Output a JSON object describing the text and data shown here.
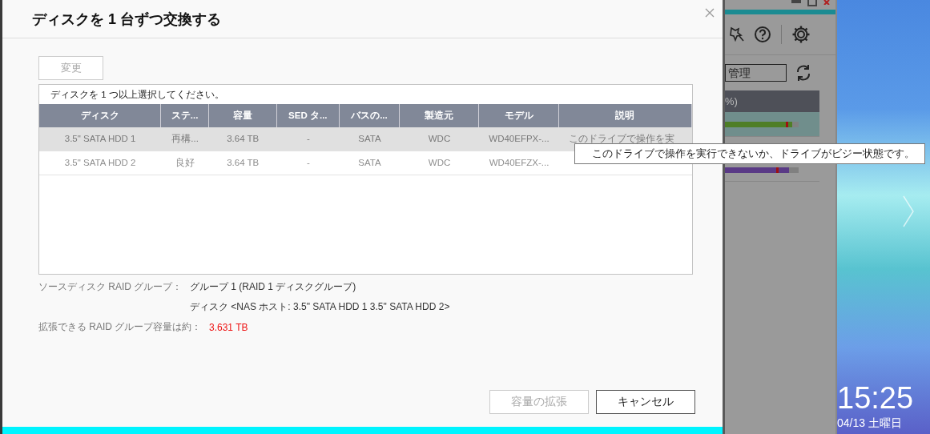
{
  "dialog": {
    "title": "ディスクを 1 台ずつ交換する",
    "change_button": {
      "label": "変更",
      "disabled": true
    },
    "table": {
      "caption": "ディスクを 1 つ以上選択してください。",
      "columns": [
        "ディスク",
        "ステ...",
        "容量",
        "SED タ...",
        "バスの...",
        "製造元",
        "モデル",
        "説明"
      ],
      "rows": [
        {
          "selected": true,
          "disabled": true,
          "cells": [
            "3.5\" SATA HDD 1",
            "再構...",
            "3.64 TB",
            "-",
            "SATA",
            "WDC",
            "WD40EFPX-...",
            "このドライブで操作を実"
          ]
        },
        {
          "selected": false,
          "disabled": true,
          "cells": [
            "3.5\" SATA HDD 2",
            "良好",
            "3.64 TB",
            "-",
            "SATA",
            "WDC",
            "WD40EFZX-..."
          ]
        }
      ]
    },
    "source_label": "ソースディスク RAID グループ：",
    "source_group": "グループ 1 (RAID 1 ディスクグループ)",
    "source_disks": "ディスク <NAS ホスト: 3.5\" SATA HDD 1 3.5\" SATA HDD 2>",
    "capacity_label": "拡張できる RAID グループ容量は約：",
    "capacity_value": "3.631 TB",
    "buttons": [
      {
        "label": "容量の拡張",
        "disabled": true
      },
      {
        "label": "キャンセル",
        "disabled": false
      }
    ]
  },
  "tooltip": "このドライブで操作を実行できないか、ドライブがビジー状態です。",
  "background_app": {
    "field_value": "管理",
    "header_text": "%)"
  },
  "desktop": {
    "time": "15:25",
    "date": "04/13 土曜日"
  }
}
